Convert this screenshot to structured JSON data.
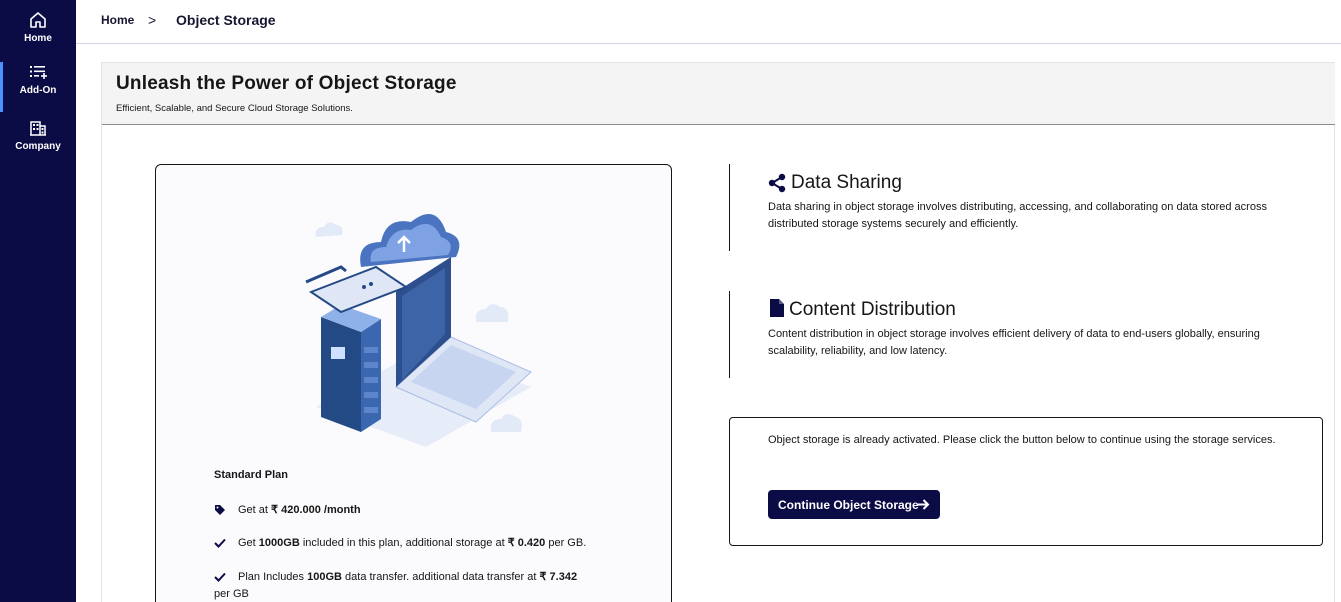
{
  "sidebar": {
    "items": [
      {
        "label": "Home",
        "icon": "home-icon"
      },
      {
        "label": "Add-On",
        "icon": "add-list-icon"
      },
      {
        "label": "Company",
        "icon": "building-icon"
      }
    ],
    "accent": "#0b0b45"
  },
  "breadcrumb": {
    "home": "Home",
    "separator": ">",
    "current": "Object Storage"
  },
  "page": {
    "title": "Unleash the Power of Object Storage",
    "subtitle": "Efficient, Scalable, and Secure Cloud Storage Solutions."
  },
  "plan": {
    "name": "Standard Plan",
    "price_prefix": "Get at ",
    "price": "₹ 420.000 /month",
    "storage_prefix": "Get ",
    "storage_amount": "1000GB",
    "storage_mid": " included in this plan, additional storage at ",
    "storage_rate": "₹ 0.420",
    "storage_suffix": " per GB.",
    "transfer_prefix": "Plan Includes ",
    "transfer_amount": "100GB",
    "transfer_mid": " data transfer. additional data transfer at ",
    "transfer_rate": "₹ 7.342",
    "transfer_suffix": " per GB"
  },
  "data_sharing": {
    "title": "Data Sharing",
    "icon": "share-icon",
    "description": "Data sharing in object storage involves distributing, accessing, and collaborating on data stored across distributed storage systems securely and efficiently."
  },
  "content_distribution": {
    "title": "Content Distribution",
    "icon": "document-icon",
    "description": "Content distribution in object storage involves efficient delivery of data to end-users globally, ensuring scalability, reliability, and low latency."
  },
  "activation": {
    "message": "Object storage is already activated. Please click the button below to continue using the storage services.",
    "button_label": "Continue Object Storage"
  }
}
